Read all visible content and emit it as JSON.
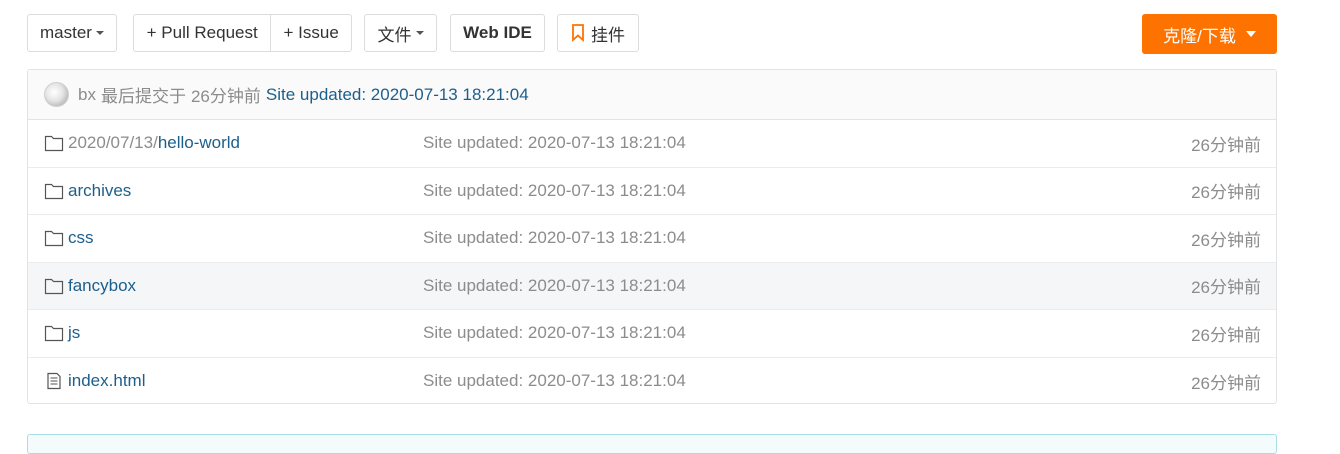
{
  "toolbar": {
    "branch": "master",
    "pull_request": "+ Pull Request",
    "issue": "+ Issue",
    "files": "文件",
    "web_ide": "Web IDE",
    "widget": "挂件",
    "clone": "克隆/下载"
  },
  "commit": {
    "author": "bx",
    "prefix": "最后提交于",
    "time": "26分钟前",
    "message": "Site updated: 2020-07-13 18:21:04"
  },
  "files": [
    {
      "path_prefix": "2020/07/13/",
      "name": "hello-world",
      "type": "folder",
      "message": "Site updated: 2020-07-13 18:21:04",
      "time": "26分钟前"
    },
    {
      "path_prefix": "",
      "name": "archives",
      "type": "folder",
      "message": "Site updated: 2020-07-13 18:21:04",
      "time": "26分钟前"
    },
    {
      "path_prefix": "",
      "name": "css",
      "type": "folder",
      "message": "Site updated: 2020-07-13 18:21:04",
      "time": "26分钟前"
    },
    {
      "path_prefix": "",
      "name": "fancybox",
      "type": "folder",
      "message": "Site updated: 2020-07-13 18:21:04",
      "time": "26分钟前"
    },
    {
      "path_prefix": "",
      "name": "js",
      "type": "folder",
      "message": "Site updated: 2020-07-13 18:21:04",
      "time": "26分钟前"
    },
    {
      "path_prefix": "",
      "name": "index.html",
      "type": "file",
      "message": "Site updated: 2020-07-13 18:21:04",
      "time": "26分钟前"
    }
  ],
  "colors": {
    "accent": "#fe7300",
    "link": "#1d5f8c",
    "muted": "#8c8c8c"
  }
}
